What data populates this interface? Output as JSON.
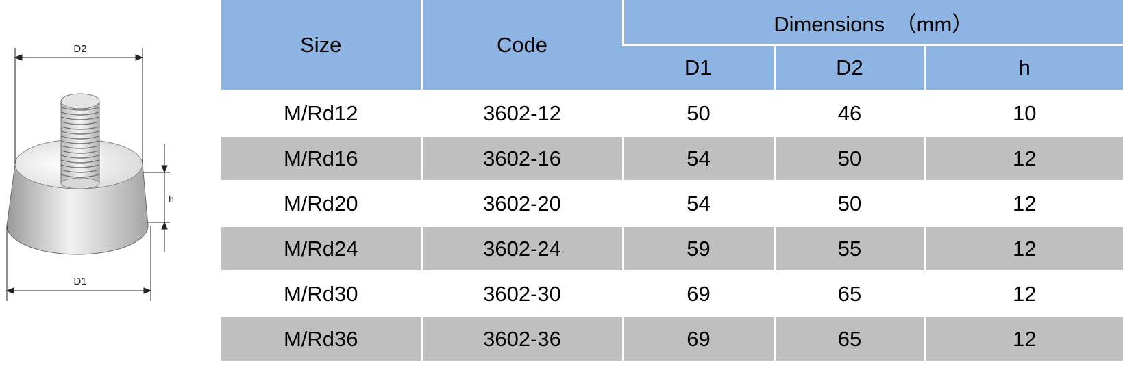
{
  "drawing": {
    "label_d2": "D2",
    "label_d1": "D1",
    "label_h": "h"
  },
  "table": {
    "headers": {
      "size": "Size",
      "code": "Code",
      "dimensions": "Dimensions　（mm）",
      "d1": "D1",
      "d2": "D2",
      "h": "h"
    },
    "rows": [
      {
        "size": "M/Rd12",
        "code": "3602-12",
        "d1": "50",
        "d2": "46",
        "h": "10"
      },
      {
        "size": "M/Rd16",
        "code": "3602-16",
        "d1": "54",
        "d2": "50",
        "h": "12"
      },
      {
        "size": "M/Rd20",
        "code": "3602-20",
        "d1": "54",
        "d2": "50",
        "h": "12"
      },
      {
        "size": "M/Rd24",
        "code": "3602-24",
        "d1": "59",
        "d2": "55",
        "h": "12"
      },
      {
        "size": "M/Rd30",
        "code": "3602-30",
        "d1": "69",
        "d2": "65",
        "h": "12"
      },
      {
        "size": "M/Rd36",
        "code": "3602-36",
        "d1": "69",
        "d2": "65",
        "h": "12"
      }
    ]
  },
  "colors": {
    "header_bg": "#8eb4e3",
    "row_alt_bg": "#bfbfbf"
  }
}
